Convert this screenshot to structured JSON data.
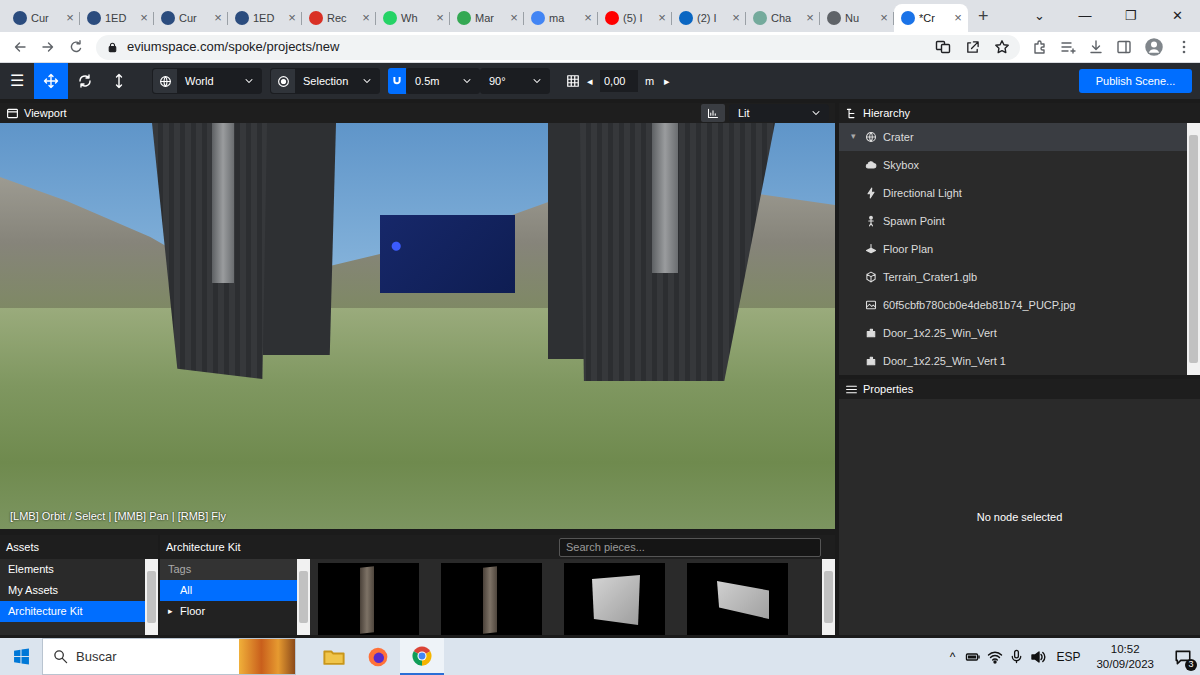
{
  "browser": {
    "tabs": [
      {
        "label": "Cur",
        "selected": false,
        "color": "#2b4c7e"
      },
      {
        "label": "1ED",
        "selected": false,
        "color": "#2b4c7e"
      },
      {
        "label": "Cur",
        "selected": false,
        "color": "#2b4c7e"
      },
      {
        "label": "1ED",
        "selected": false,
        "color": "#2b4c7e"
      },
      {
        "label": "Rec",
        "selected": false,
        "color": "#d93025"
      },
      {
        "label": "Wh",
        "selected": false,
        "color": "#25d366"
      },
      {
        "label": "Mar",
        "selected": false,
        "color": "#34a853"
      },
      {
        "label": "ma",
        "selected": false,
        "color": "#4285f4"
      },
      {
        "label": "(5) I",
        "selected": false,
        "color": "#ff0000"
      },
      {
        "label": "(2) I",
        "selected": false,
        "color": "#0a66c2"
      },
      {
        "label": "Cha",
        "selected": false,
        "color": "#74aa9c"
      },
      {
        "label": "Nu",
        "selected": false,
        "color": "#5f6368"
      },
      {
        "label": "*Cr",
        "selected": true,
        "color": "#1a73e8"
      }
    ],
    "tab_close": "×",
    "new_tab": "+",
    "window_buttons": [
      "⌄",
      "—",
      "❐",
      "✕"
    ],
    "address": "eviumspace.com/spoke/projects/new"
  },
  "toolbar": {
    "menu": "☰",
    "tools": [
      {
        "kind": "move",
        "selected": true
      },
      {
        "kind": "rotate",
        "selected": false
      },
      {
        "kind": "scale",
        "selected": false
      }
    ],
    "space": {
      "value": "World"
    },
    "pivot": {
      "value": "Selection"
    },
    "snap": {
      "on": true,
      "distance": "0.5m",
      "angle": "90°"
    },
    "grid": {
      "height": "0,00",
      "unit": "m",
      "dec": "◂",
      "inc": "▸"
    },
    "publish": "Publish Scene..."
  },
  "viewport": {
    "title": "Viewport",
    "shading": "Lit",
    "hint": "[LMB] Orbit / Select | [MMB] Pan | [RMB] Fly"
  },
  "hierarchy": {
    "title": "Hierarchy",
    "expander": "▾",
    "items": [
      {
        "label": "Crater",
        "kind": "scene",
        "expanded": true,
        "hovered": true,
        "children": [
          {
            "label": "Skybox",
            "kind": "skybox",
            "hovered": false
          },
          {
            "label": "Directional Light",
            "kind": "light",
            "hovered": false
          },
          {
            "label": "Spawn Point",
            "kind": "spawn",
            "hovered": false
          },
          {
            "label": "Floor Plan",
            "kind": "floor",
            "hovered": false
          },
          {
            "label": "Terrain_Crater1.glb",
            "kind": "model",
            "hovered": false
          },
          {
            "label": "60f5cbfb780cb0e4deb81b74_PUCP.jpg",
            "kind": "image",
            "hovered": false
          },
          {
            "label": "Door_1x2.25_Win_Vert",
            "kind": "kit",
            "hovered": false
          },
          {
            "label": "Door_1x2.25_Win_Vert 1",
            "kind": "kit",
            "hovered": false
          }
        ]
      }
    ]
  },
  "properties": {
    "title": "Properties",
    "empty": "No node selected"
  },
  "assets": {
    "title": "Assets",
    "sources": [
      {
        "label": "Elements",
        "selected": false
      },
      {
        "label": "My Assets",
        "selected": false
      },
      {
        "label": "Architecture Kit",
        "selected": true
      }
    ],
    "panel_title": "Architecture Kit",
    "search": {
      "placeholder": "Search pieces..."
    },
    "tags_title": "Tags",
    "tag_caret": "▸",
    "tags": [
      {
        "label": "All",
        "selected": true,
        "expandable": false
      },
      {
        "label": "Floor",
        "selected": false,
        "expandable": true
      }
    ],
    "pieces": [
      {
        "kind": "pillar"
      },
      {
        "kind": "pillar"
      },
      {
        "kind": "panel"
      },
      {
        "kind": "panel-flat"
      }
    ]
  },
  "taskbar": {
    "search": "Buscar",
    "apps": [
      {
        "kind": "explorer",
        "selected": false
      },
      {
        "kind": "firefox",
        "selected": false
      },
      {
        "kind": "chrome",
        "selected": true
      }
    ],
    "tray_caret": "^",
    "language": "ESP",
    "time": "10:52",
    "date": "30/09/2023",
    "notifications": "3"
  }
}
